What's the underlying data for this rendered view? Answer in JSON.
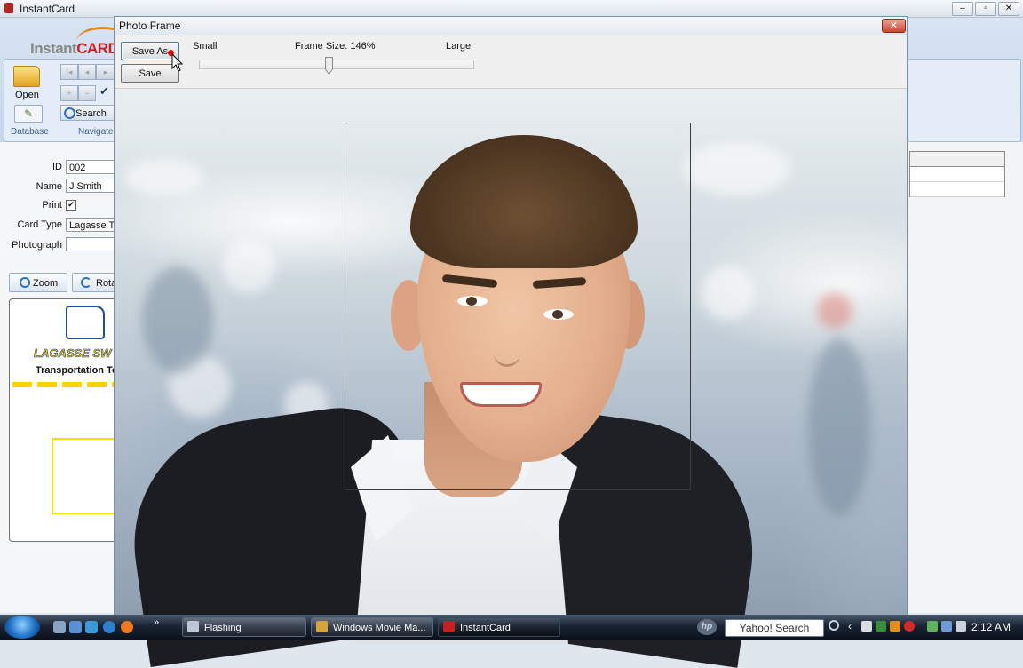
{
  "app": {
    "title": "InstantCard",
    "logo_left": "Instant",
    "logo_right": "CARD",
    "ribbon": {
      "open_label": "Open",
      "search_label": "Search",
      "group_database": "Database",
      "group_navigate": "Navigate"
    }
  },
  "form": {
    "id_label": "ID",
    "id_value": "002",
    "name_label": "Name",
    "name_value": "J Smith",
    "print_label": "Print",
    "print_checked": "✔",
    "card_type_label": "Card Type",
    "card_type_value": "Lagasse Tra",
    "photograph_label": "Photograph",
    "photograph_value": "",
    "zoom_label": "Zoom",
    "rotate_label": "Rota"
  },
  "card": {
    "brand": "LAGASSE SW",
    "tagline": "Transportation Te"
  },
  "dialog": {
    "title": "Photo Frame",
    "close_label": "✕",
    "save_as_label": "Save As",
    "save_label": "Save",
    "slider_min_label": "Small",
    "slider_value_label": "Frame Size: 146%",
    "slider_max_label": "Large",
    "frame_size_percent": 146
  },
  "taskbar": {
    "tasks": [
      {
        "label": "Flashing"
      },
      {
        "label": "Windows Movie Ma..."
      },
      {
        "label": "InstantCard"
      }
    ],
    "search_label": "Yahoo! Search",
    "hp_label": "hp",
    "clock": "2:12 AM"
  },
  "colors": {
    "accent_red": "#c62020",
    "title_bar": "#e2e8f0",
    "taskbar": "#1a2434"
  }
}
